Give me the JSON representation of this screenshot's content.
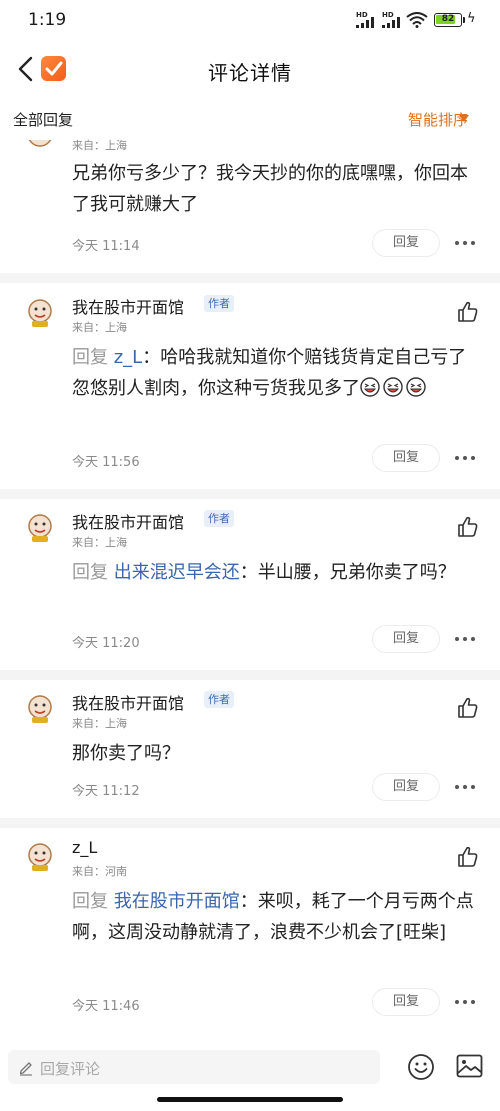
{
  "status": {
    "time": "1:19",
    "signal1_label": "HD",
    "signal2_label": "HD",
    "battery": "82",
    "battery_level": 0.82
  },
  "nav": {
    "title": "评论详情",
    "back_icon": "chevron-left-icon",
    "app_icon": "checkbox-app-icon"
  },
  "filter": {
    "all_label": "全部回复",
    "sort_label": "智能排序"
  },
  "comments": [
    {
      "location": "来自：上海",
      "text": "兄弟你亏多少了？我今天抄的你的底嘿嘿，你回本了我可就赚大了",
      "time": "今天 11:14",
      "reply_label": "回复"
    },
    {
      "name": "我在股市开面馆",
      "badge": "作者",
      "location": "来自：上海",
      "reply_prefix": "回复",
      "mention": "z_L",
      "text": "：哈哈我就知道你个赔钱货肯定自己亏了忽悠别人割肉，你这种亏货我见多了",
      "emoji_count": 3,
      "time": "今天 11:56",
      "reply_label": "回复"
    },
    {
      "name": "我在股市开面馆",
      "badge": "作者",
      "location": "来自：上海",
      "reply_prefix": "回复",
      "mention": "出来混迟早会还",
      "text": "：半山腰，兄弟你卖了吗？",
      "time": "今天 11:20",
      "reply_label": "回复"
    },
    {
      "name": "我在股市开面馆",
      "badge": "作者",
      "location": "来自：上海",
      "text": "那你卖了吗？",
      "time": "今天 11:12",
      "reply_label": "回复"
    },
    {
      "name": "z_L",
      "location": "来自：河南",
      "reply_prefix": "回复",
      "mention": "我在股市开面馆",
      "text": "：来呗，耗了一个月亏两个点啊，这周没动静就清了，浪费不少机会了[旺柴]",
      "time": "今天 11:46",
      "reply_label": "回复"
    }
  ],
  "bottom": {
    "input_placeholder": "回复评论",
    "emoji_icon": "smile-icon",
    "image_icon": "image-icon"
  }
}
